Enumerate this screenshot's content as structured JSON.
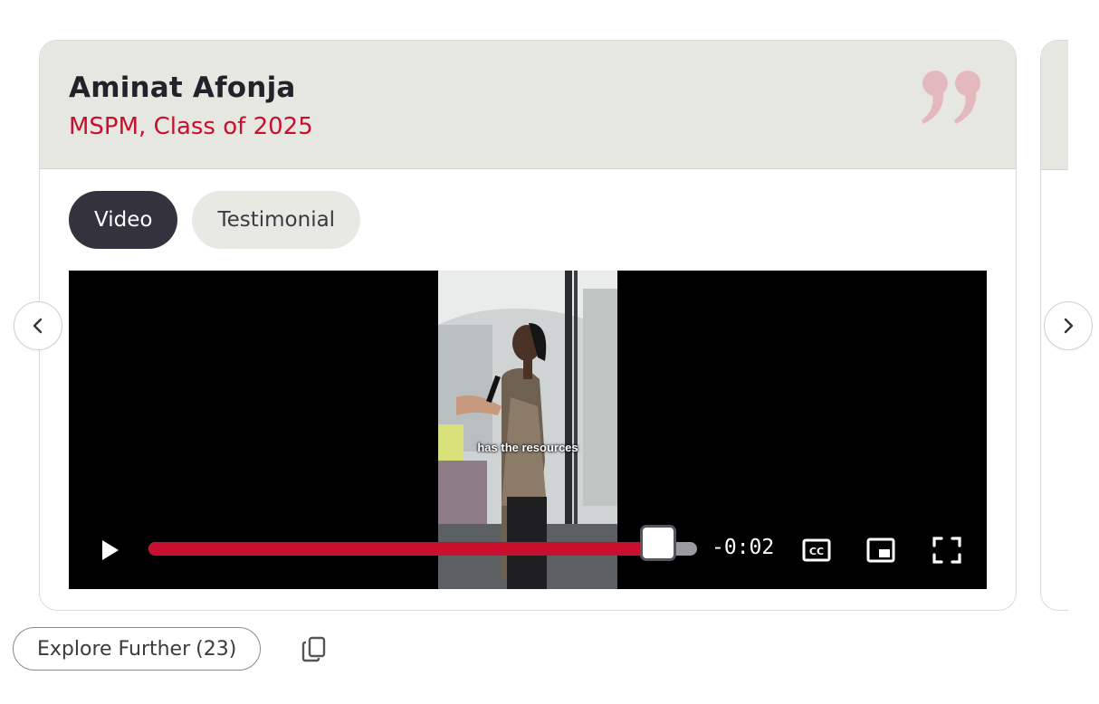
{
  "testimonial": {
    "name": "Aminat Afonja",
    "program": "MSPM, Class of 2025"
  },
  "tabs": [
    {
      "label": "Video",
      "active": true
    },
    {
      "label": "Testimonial",
      "active": false
    }
  ],
  "video": {
    "caption": "has the resources",
    "time_remaining": "-0:02",
    "progress": 0.93,
    "accent_color": "#c8102e"
  },
  "explore": {
    "label": "Explore Further",
    "count": "(23)"
  },
  "icons": {
    "quote": "quote-icon",
    "prev": "chevron-left-icon",
    "next": "chevron-right-icon",
    "play": "play-icon",
    "captions": "closed-captions-icon",
    "pip": "picture-in-picture-icon",
    "fullscreen": "fullscreen-icon",
    "copy": "copy-icon"
  }
}
